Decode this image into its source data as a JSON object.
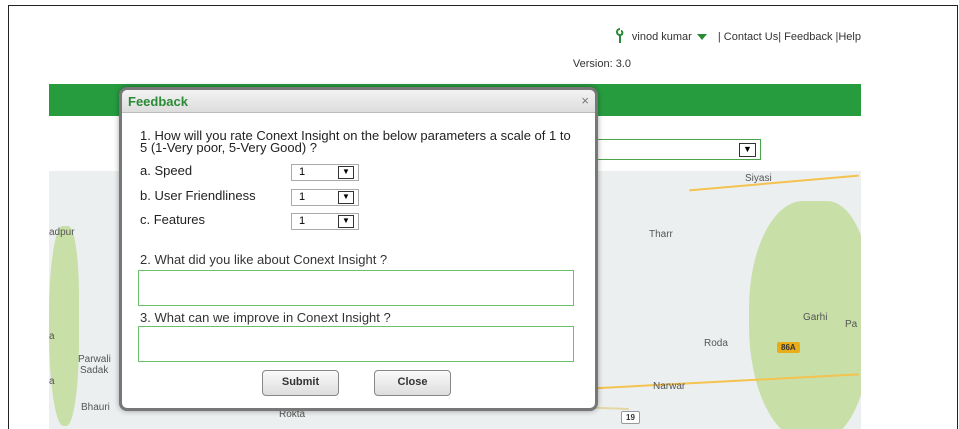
{
  "header": {
    "user_name": "vinod kumar",
    "links": [
      "Contact Us|",
      "Feedback |Help"
    ],
    "version_label": "Version: 3.0",
    "user_icon": "user-icon"
  },
  "outer_select": {
    "value": ""
  },
  "map": {
    "labels": [
      "adpur",
      "Parwali",
      "Sadak",
      "Bhauri",
      "Rokta",
      "Tharr",
      "Siyasi",
      "Garhi",
      "Pa",
      "Roda",
      "Narwar",
      "a",
      "a"
    ],
    "shield_86A": "86A",
    "shield_19": "19"
  },
  "modal": {
    "title": "Feedback",
    "close": "×",
    "q1": "1. How will you rate Conext Insight on the below parameters a scale of 1 to 5 (1-Very poor, 5-Very Good) ?",
    "rows": [
      {
        "label": "a. Speed",
        "value": "1"
      },
      {
        "label": "b. User Friendliness",
        "value": "1"
      },
      {
        "label": "c. Features",
        "value": "1"
      }
    ],
    "q2": "2. What did you like about Conext Insight ?",
    "q3": "3. What can we improve in Conext Insight ?",
    "submit": "Submit",
    "close_button": "Close"
  }
}
